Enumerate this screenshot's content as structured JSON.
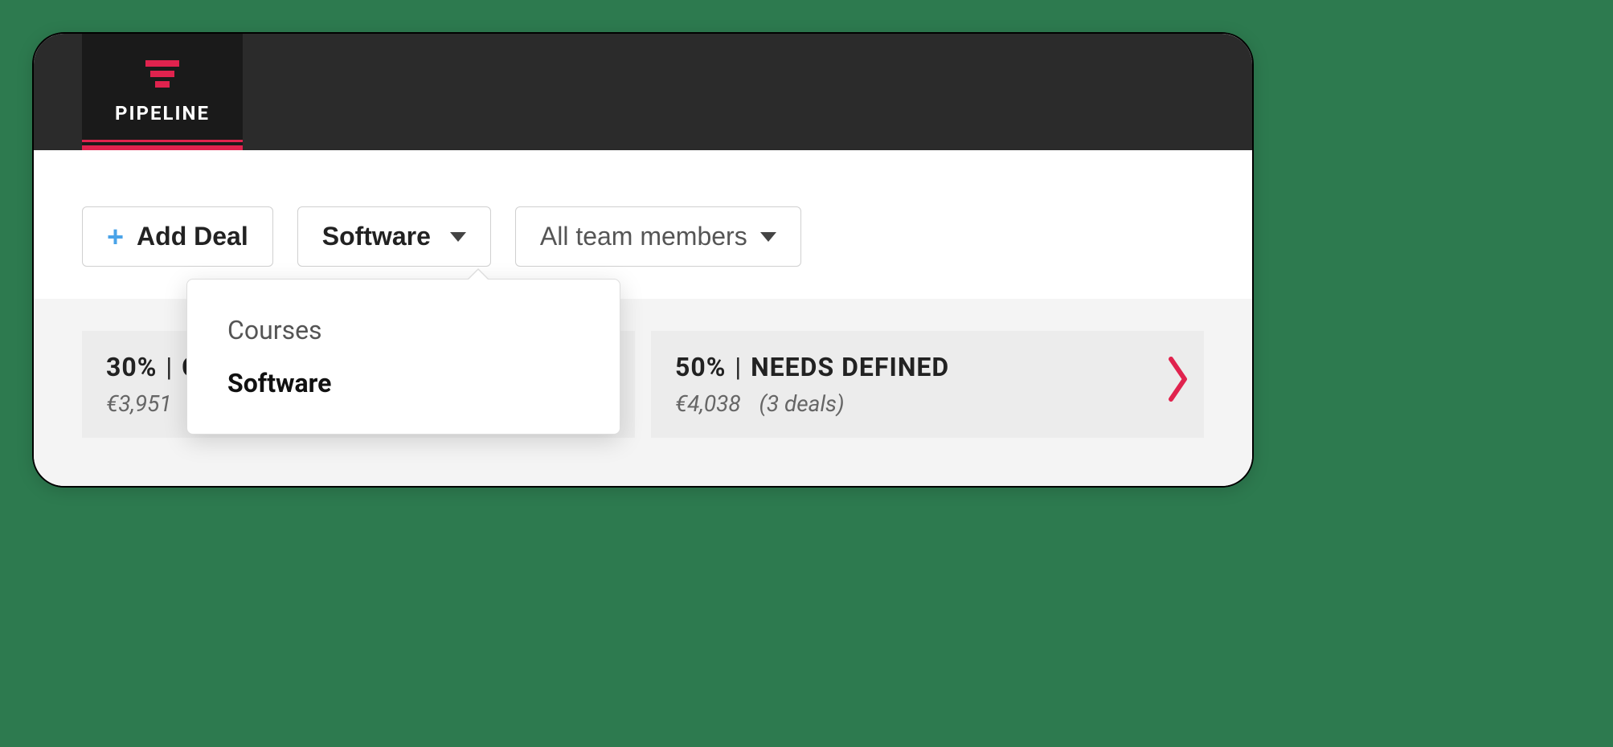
{
  "header": {
    "tab_label": "PIPELINE"
  },
  "toolbar": {
    "add_deal_label": "Add Deal",
    "pipeline_filter": {
      "selected": "Software",
      "options": [
        "Courses",
        "Software"
      ]
    },
    "team_filter": {
      "selected": "All team members"
    }
  },
  "stages": [
    {
      "percent": "30%",
      "name_truncated": "C",
      "amount": "€3,951"
    },
    {
      "percent": "50%",
      "name": "NEEDS DEFINED",
      "amount": "€4,038",
      "deals": "(3 deals)"
    }
  ],
  "colors": {
    "accent": "#e0234e",
    "icon_blue": "#4aa3e8"
  }
}
